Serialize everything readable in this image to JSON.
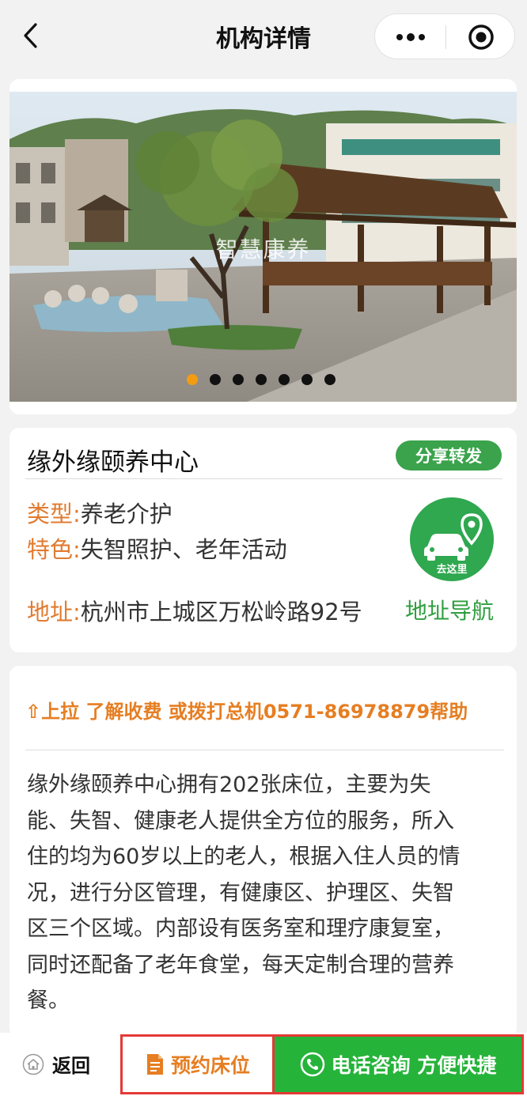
{
  "nav": {
    "title": "机构详情"
  },
  "banner": {
    "overlay_text": "智慧康养",
    "slide_count": 7,
    "active_index": 0
  },
  "info": {
    "name": "缘外缘颐养中心",
    "share_label": "分享转发",
    "type_label": "类型:",
    "type_value": "养老介护",
    "feature_label": "特色:",
    "feature_value": "失智照护、老年活动",
    "address_label": "地址:",
    "address_value": "杭州市上城区万松岭路92号",
    "go_label": "去这里",
    "nav_label": "地址导航"
  },
  "desc": {
    "hint": "⇧上拉 了解收费 或拨打总机0571-86978879帮助",
    "lines": [
      "缘外缘颐养中心拥有202张床位，主要为失",
      "能、失智、健康老人提供全方位的服务，所入",
      "住的均为60岁以上的老人，根据入住人员的情",
      "况，进行分区管理，有健康区、护理区、失智",
      "区三个区域。内部设有医务室和理疗康复室，",
      "同时还配备了老年食堂，每天定制合理的营养",
      "餐。"
    ]
  },
  "bottom": {
    "back_label": "返回",
    "reserve_label": "预约床位",
    "call_label": "电话咨询 方便快捷"
  },
  "colors": {
    "accent_orange": "#e67e22",
    "accent_green": "#26b33a",
    "highlight_red": "#e53935"
  },
  "icons": [
    "back-chevron-icon",
    "more-dots-icon",
    "target-icon",
    "car-location-icon",
    "home-icon",
    "document-icon",
    "phone-icon"
  ]
}
